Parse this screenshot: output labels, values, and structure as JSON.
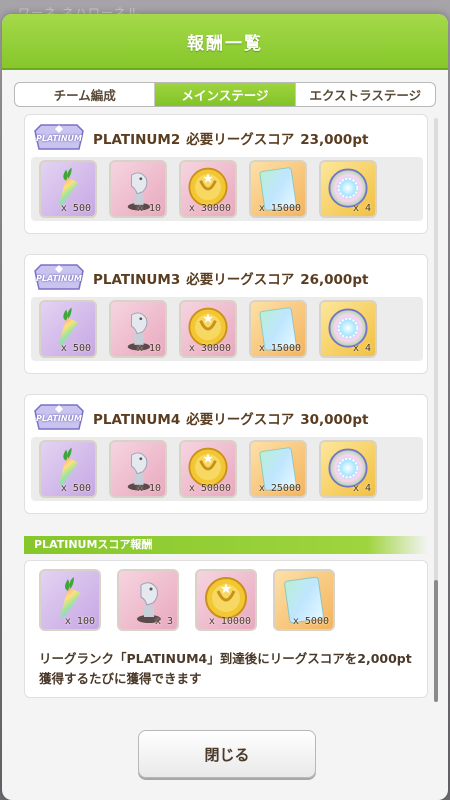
{
  "background": {
    "text": "ワーネ ネハローネル"
  },
  "dialog": {
    "title": "報酬一覧"
  },
  "tabs": [
    {
      "label": "チーム編成",
      "active": false
    },
    {
      "label": "メインステージ",
      "active": true
    },
    {
      "label": "エクストラステージ",
      "active": false
    }
  ],
  "ranks": [
    {
      "badge": "PLATINUM",
      "rank_label": "PLATINUM2",
      "requirement": "必要リーグスコア",
      "score": "23,000pt",
      "items": [
        {
          "icon": "carrot-icon",
          "qty": "x 500"
        },
        {
          "icon": "horse-figure-icon",
          "qty": "x 10"
        },
        {
          "icon": "gold-coin-icon",
          "qty": "x 30000"
        },
        {
          "icon": "ticket-card-icon",
          "qty": "x 15000"
        },
        {
          "icon": "rainbow-orb-icon",
          "qty": "x 4"
        }
      ]
    },
    {
      "badge": "PLATINUM",
      "rank_label": "PLATINUM3",
      "requirement": "必要リーグスコア",
      "score": "26,000pt",
      "items": [
        {
          "icon": "carrot-icon",
          "qty": "x 500"
        },
        {
          "icon": "horse-figure-icon",
          "qty": "x 10"
        },
        {
          "icon": "gold-coin-icon",
          "qty": "x 30000"
        },
        {
          "icon": "ticket-card-icon",
          "qty": "x 15000"
        },
        {
          "icon": "rainbow-orb-icon",
          "qty": "x 4"
        }
      ]
    },
    {
      "badge": "PLATINUM",
      "rank_label": "PLATINUM4",
      "requirement": "必要リーグスコア",
      "score": "30,000pt",
      "items": [
        {
          "icon": "carrot-icon",
          "qty": "x 500"
        },
        {
          "icon": "horse-figure-icon",
          "qty": "x 10"
        },
        {
          "icon": "gold-coin-icon",
          "qty": "x 50000"
        },
        {
          "icon": "ticket-card-icon",
          "qty": "x 25000"
        },
        {
          "icon": "rainbow-orb-icon",
          "qty": "x 4"
        }
      ]
    }
  ],
  "score_reward": {
    "header": "PLATINUMスコア報酬",
    "items": [
      {
        "icon": "carrot-icon",
        "qty": "x 100"
      },
      {
        "icon": "horse-figure-icon",
        "qty": "x 3"
      },
      {
        "icon": "gold-coin-icon",
        "qty": "x 10000"
      },
      {
        "icon": "ticket-card-icon",
        "qty": "x 5000"
      }
    ],
    "description": "リーグランク「PLATINUM4」到達後にリーグスコアを2,000pt獲得するたびに獲得できます"
  },
  "close_button": "閉じる",
  "colors": {
    "accent_green": "#86c72b",
    "title_brown": "#5a3d20"
  }
}
